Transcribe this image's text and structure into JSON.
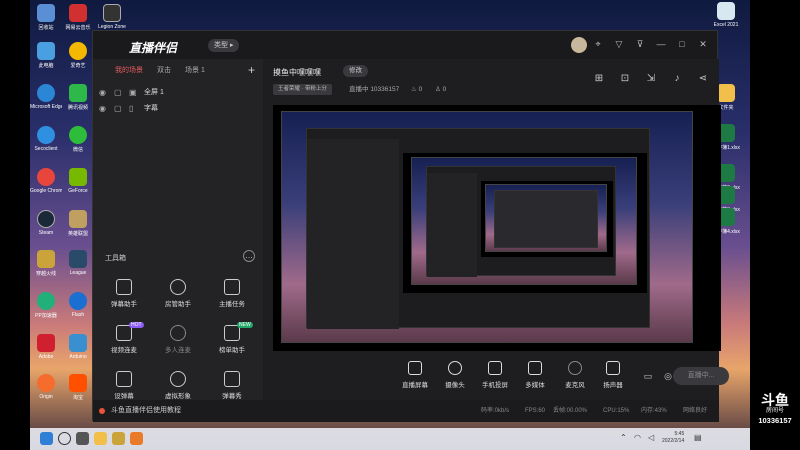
{
  "desktop": {
    "left_icons": [
      {
        "label": "回收站",
        "color": "#5a8fd6"
      },
      {
        "label": "网易云音乐",
        "color": "#d0302f"
      },
      {
        "label": "Legion Zone",
        "color": "#333"
      },
      {
        "label": "此电脑",
        "color": "#4a9fe0"
      },
      {
        "label": "爱奇艺",
        "color": "#f5b800"
      },
      {
        "label": "Microsoft Edge",
        "color": "#2b86d6"
      },
      {
        "label": "腾讯视频",
        "color": "#2fb84a"
      },
      {
        "label": "Secoclient",
        "color": "#2f8fe0"
      },
      {
        "label": "微信",
        "color": "#2dbd3a"
      },
      {
        "label": "Google Chrome",
        "color": "#e8453c"
      },
      {
        "label": "GeForce",
        "color": "#76b900"
      },
      {
        "label": "Steam",
        "color": "#1b2838"
      },
      {
        "label": "英雄联盟",
        "color": "#c0a060"
      },
      {
        "label": "穿越火线",
        "color": "#caa43a"
      },
      {
        "label": "League",
        "color": "#2a4a6a"
      },
      {
        "label": "PP加速器",
        "color": "#22b07a"
      },
      {
        "label": "Flash",
        "color": "#1a6fd0"
      },
      {
        "label": "Adobe",
        "color": "#d02030"
      },
      {
        "label": "Arduino",
        "color": "#3a8fd0"
      },
      {
        "label": "Origin",
        "color": "#f56c2d"
      },
      {
        "label": "淘宝",
        "color": "#ff5000"
      }
    ],
    "right_icons": [
      {
        "label": "Excel 2021",
        "color": "#d8e8f0"
      },
      {
        "label": "文件夹",
        "color": "#f2c04a"
      },
      {
        "label": "工作簿1.xlsx",
        "color": "#1e7a45"
      },
      {
        "label": "工作簿2.xlsx",
        "color": "#1e7a45"
      },
      {
        "label": "工作簿3.xlsx",
        "color": "#1e7a45"
      },
      {
        "label": "工作簿4.xlsx",
        "color": "#1e7a45"
      }
    ]
  },
  "app": {
    "logo": "直播伴侣",
    "type_button": "类型",
    "titlebar_icons": [
      "message-icon",
      "pin-icon",
      "shirt-icon",
      "filter-icon",
      "minimize-icon",
      "maximize-icon",
      "close-icon"
    ],
    "sidebar": {
      "tabs": [
        "我的场景",
        "双击",
        "场景 1"
      ],
      "add": "+",
      "items": [
        {
          "label": "全屏 1",
          "icon": "▣"
        },
        {
          "label": "字幕",
          "icon": "▯"
        }
      ],
      "toolbox_title": "工具箱",
      "tools": [
        {
          "label": "弹幕助手",
          "badge": ""
        },
        {
          "label": "房管助手",
          "badge": ""
        },
        {
          "label": "主播任务",
          "badge": ""
        },
        {
          "label": "视频连麦",
          "badge": "HOT"
        },
        {
          "label": "多人连麦",
          "badge": ""
        },
        {
          "label": "榜单助手",
          "badge": "NEW"
        },
        {
          "label": "设弹幕",
          "badge": ""
        },
        {
          "label": "虚拟形象",
          "badge": ""
        },
        {
          "label": "弹幕秀",
          "badge": ""
        }
      ],
      "tutorial": "斗鱼直播伴侣使用教程"
    },
    "main": {
      "room_title": "摸鱼中嘿嘿嘿",
      "modify": "修改",
      "tag": "王者荣耀 · 带粉上分",
      "status": "直播中",
      "room_id": "10336157",
      "hot": "0",
      "viewers": "0",
      "header_icons": [
        "layout-icon",
        "lock-icon",
        "export-icon",
        "bell-icon",
        "share-icon"
      ]
    },
    "controls": [
      {
        "label": "直播屏幕",
        "name": "screen-capture"
      },
      {
        "label": "摄像头",
        "name": "camera"
      },
      {
        "label": "手机投屏",
        "name": "phone-cast"
      },
      {
        "label": "多媒体",
        "name": "media"
      },
      {
        "label": "麦克风",
        "name": "microphone"
      },
      {
        "label": "扬声器",
        "name": "speaker"
      }
    ],
    "go_live": "直播中...",
    "status_bar": {
      "bitrate": "码率:0kb/s",
      "fps": "FPS:60",
      "dropped": "丢帧:00.00%",
      "cpu": "CPU:15%",
      "memory": "内存:43%",
      "network": "网络良好"
    }
  },
  "taskbar": {
    "time": "5:45",
    "date": "2022/2/14"
  },
  "watermark": {
    "brand": "斗鱼",
    "sub": "房间号",
    "room": "10336157"
  }
}
